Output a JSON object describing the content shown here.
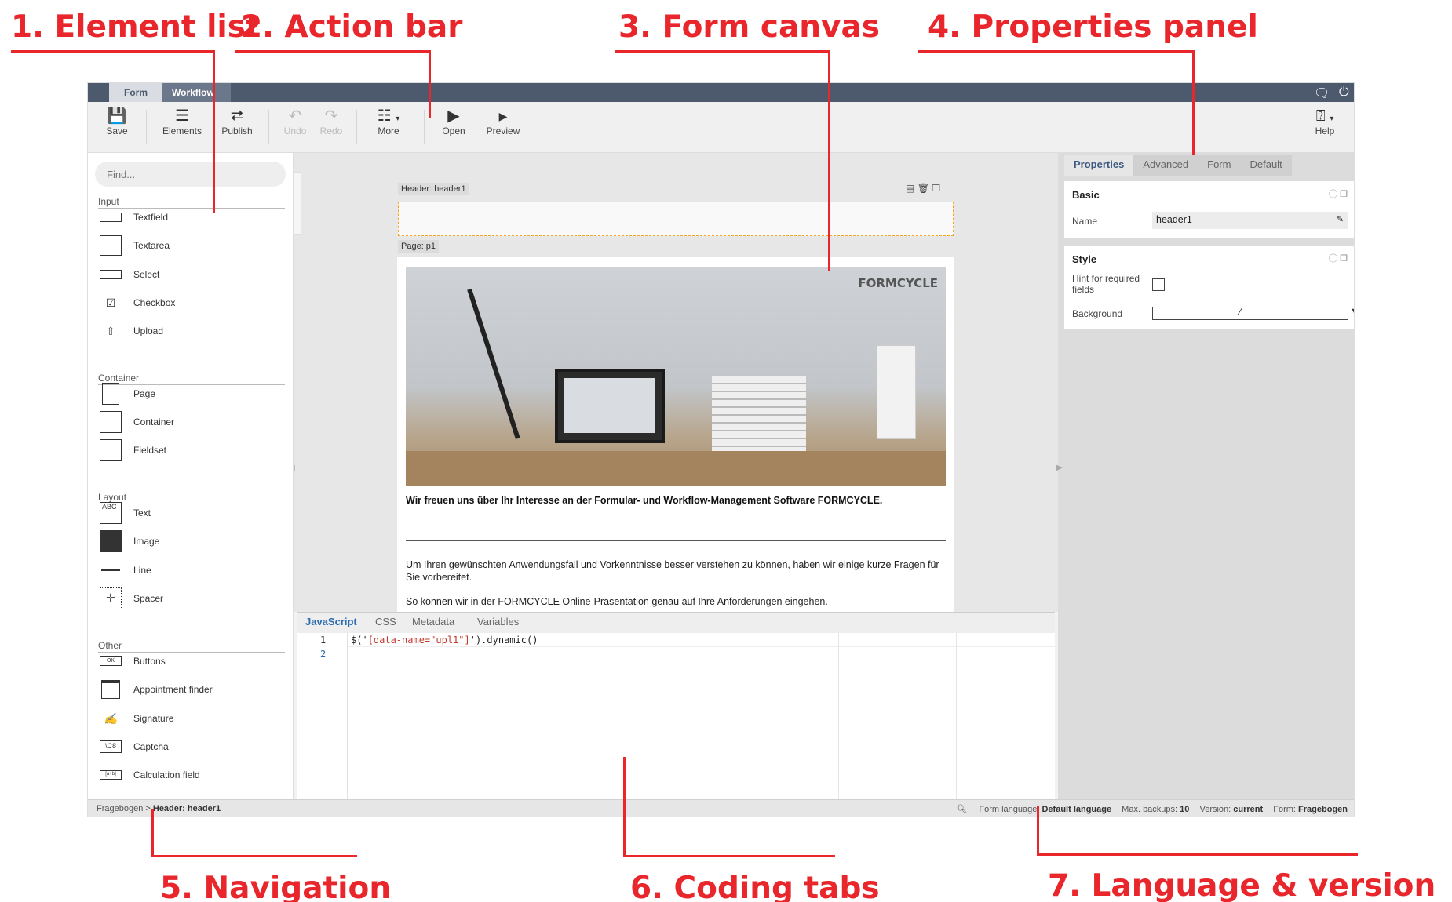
{
  "callouts": {
    "element_list": "1. Element list",
    "action_bar": "2. Action bar",
    "form_canvas": "3. Form canvas",
    "properties_panel": "4. Properties panel",
    "navigation": "5. Navigation",
    "coding_tabs": "6. Coding tabs",
    "language_version": "7. Language & version",
    "color": "#e8262b"
  },
  "topbar": {
    "tabs": [
      "Form",
      "Workflow"
    ]
  },
  "toolbar": {
    "save": "Save",
    "elements": "Elements",
    "publish": "Publish",
    "undo": "Undo",
    "redo": "Redo",
    "more": "More",
    "open": "Open",
    "preview": "Preview",
    "help": "Help"
  },
  "element_list": {
    "find_placeholder": "Find...",
    "input": {
      "title": "Input",
      "items": [
        "Textfield",
        "Textarea",
        "Select",
        "Checkbox",
        "Upload"
      ]
    },
    "container": {
      "title": "Container",
      "items": [
        "Page",
        "Container",
        "Fieldset"
      ]
    },
    "layout": {
      "title": "Layout",
      "items": [
        "Text",
        "Image",
        "Line",
        "Spacer"
      ]
    },
    "other": {
      "title": "Other",
      "items": [
        "Buttons",
        "Appointment finder",
        "Signature",
        "Captcha",
        "Calculation field"
      ]
    }
  },
  "canvas": {
    "header_chip": "Header: header1",
    "page_chip": "Page: p1",
    "brand": "FORMCYCLE",
    "lead": "Wir freuen uns über Ihr Interesse an der Formular- und Workflow-Management Software FORMCYCLE.",
    "p1": "Um Ihren gewünschten Anwendungsfall und Vorkenntnisse besser verstehen zu können, haben wir einige kurze Fragen für Sie vorbereitet.",
    "p2": "So können wir in der FORMCYCLE Online-Präsentation genau auf Ihre Anforderungen eingehen."
  },
  "code": {
    "tabs": [
      "JavaScript",
      "CSS",
      "Metadata",
      "Variables"
    ],
    "line_numbers": [
      "1",
      "2"
    ],
    "line1_prefix": "$('",
    "line1_string": "[data-name=\"upl1\"]",
    "line1_suffix": "').dynamic()"
  },
  "properties": {
    "tabs": [
      "Properties",
      "Advanced",
      "Form",
      "Default"
    ],
    "basic_title": "Basic",
    "name_label": "Name",
    "name_value": "header1",
    "style_title": "Style",
    "hint_label": "Hint for required fields",
    "background_label": "Background"
  },
  "status": {
    "breadcrumb_root": "Fragebogen",
    "breadcrumb_sep": " > ",
    "breadcrumb_current": "Header: header1",
    "lang_label": "Form language:",
    "lang_value": "Default language",
    "backups_label": "Max. backups:",
    "backups_value": "10",
    "version_label": "Version:",
    "version_value": "current",
    "form_label": "Form:",
    "form_value": "Fragebogen"
  }
}
